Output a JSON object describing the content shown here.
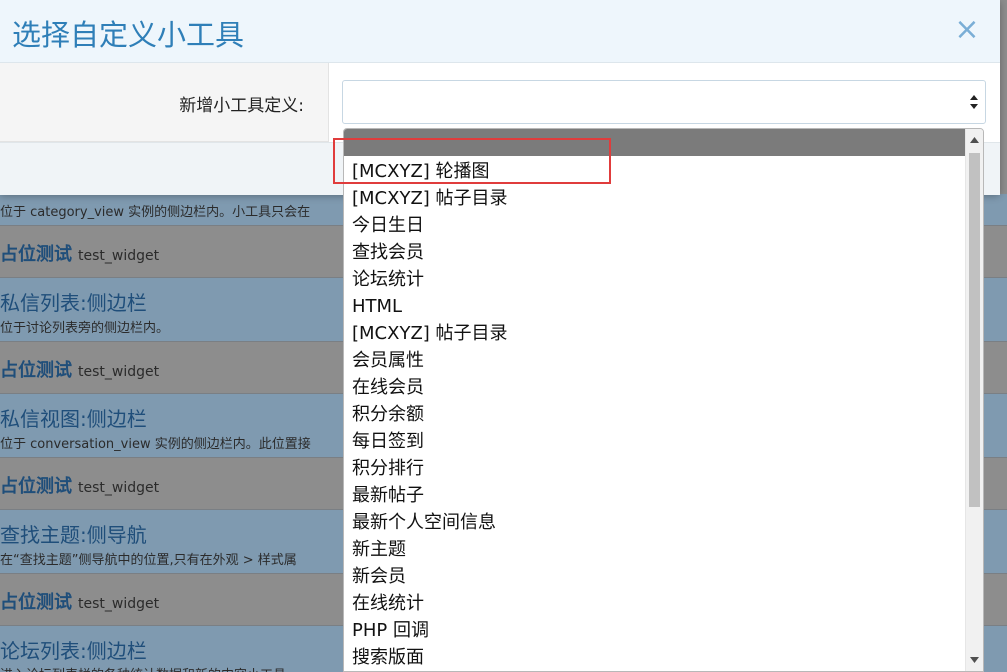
{
  "modal": {
    "title": "选择自定义小工具",
    "close_symbol": "×",
    "field_label": "新增小工具定义:",
    "selected_value": ""
  },
  "dropdown": {
    "options": [
      "",
      "[MCXYZ] 轮播图",
      "[MCXYZ] 帖子目录",
      "今日生日",
      "查找会员",
      "论坛统计",
      "HTML",
      "[MCXYZ] 帖子目录",
      "会员属性",
      "在线会员",
      "积分余额",
      "每日签到",
      "积分排行",
      "最新帖子",
      "最新个人空间信息",
      "新主题",
      "新会员",
      "在线统计",
      "PHP 回调",
      "搜索版面"
    ],
    "highlighted_option": "[MCXYZ] 轮播图"
  },
  "background": {
    "rows": [
      {
        "kind": "desc-only",
        "desc": "位于 category_view 实例的侧边栏内。小工具只会在"
      },
      {
        "kind": "test",
        "title": "占位测试",
        "id": "test_widget"
      },
      {
        "kind": "header",
        "title": "私信列表:侧边栏",
        "desc": "位于讨论列表旁的侧边栏内。"
      },
      {
        "kind": "test",
        "title": "占位测试",
        "id": "test_widget"
      },
      {
        "kind": "header",
        "title": "私信视图:侧边栏",
        "desc": "位于 conversation_view 实例的侧边栏内。此位置接"
      },
      {
        "kind": "test",
        "title": "占位测试",
        "id": "test_widget"
      },
      {
        "kind": "header",
        "title": "查找主题:侧导航",
        "desc": "在“查找主题”侧导航中的位置,只有在外观 > 样式属"
      },
      {
        "kind": "test",
        "title": "占位测试",
        "id": "test_widget"
      },
      {
        "kind": "header",
        "title": "论坛列表:侧边栏",
        "desc": "进入论坛列表栏的各种统计数据和新的内容小工具"
      }
    ]
  },
  "colors": {
    "accent": "#2f7fb8",
    "highlight": "#e03c3c",
    "selected_option_bg": "#7b7b7b"
  }
}
